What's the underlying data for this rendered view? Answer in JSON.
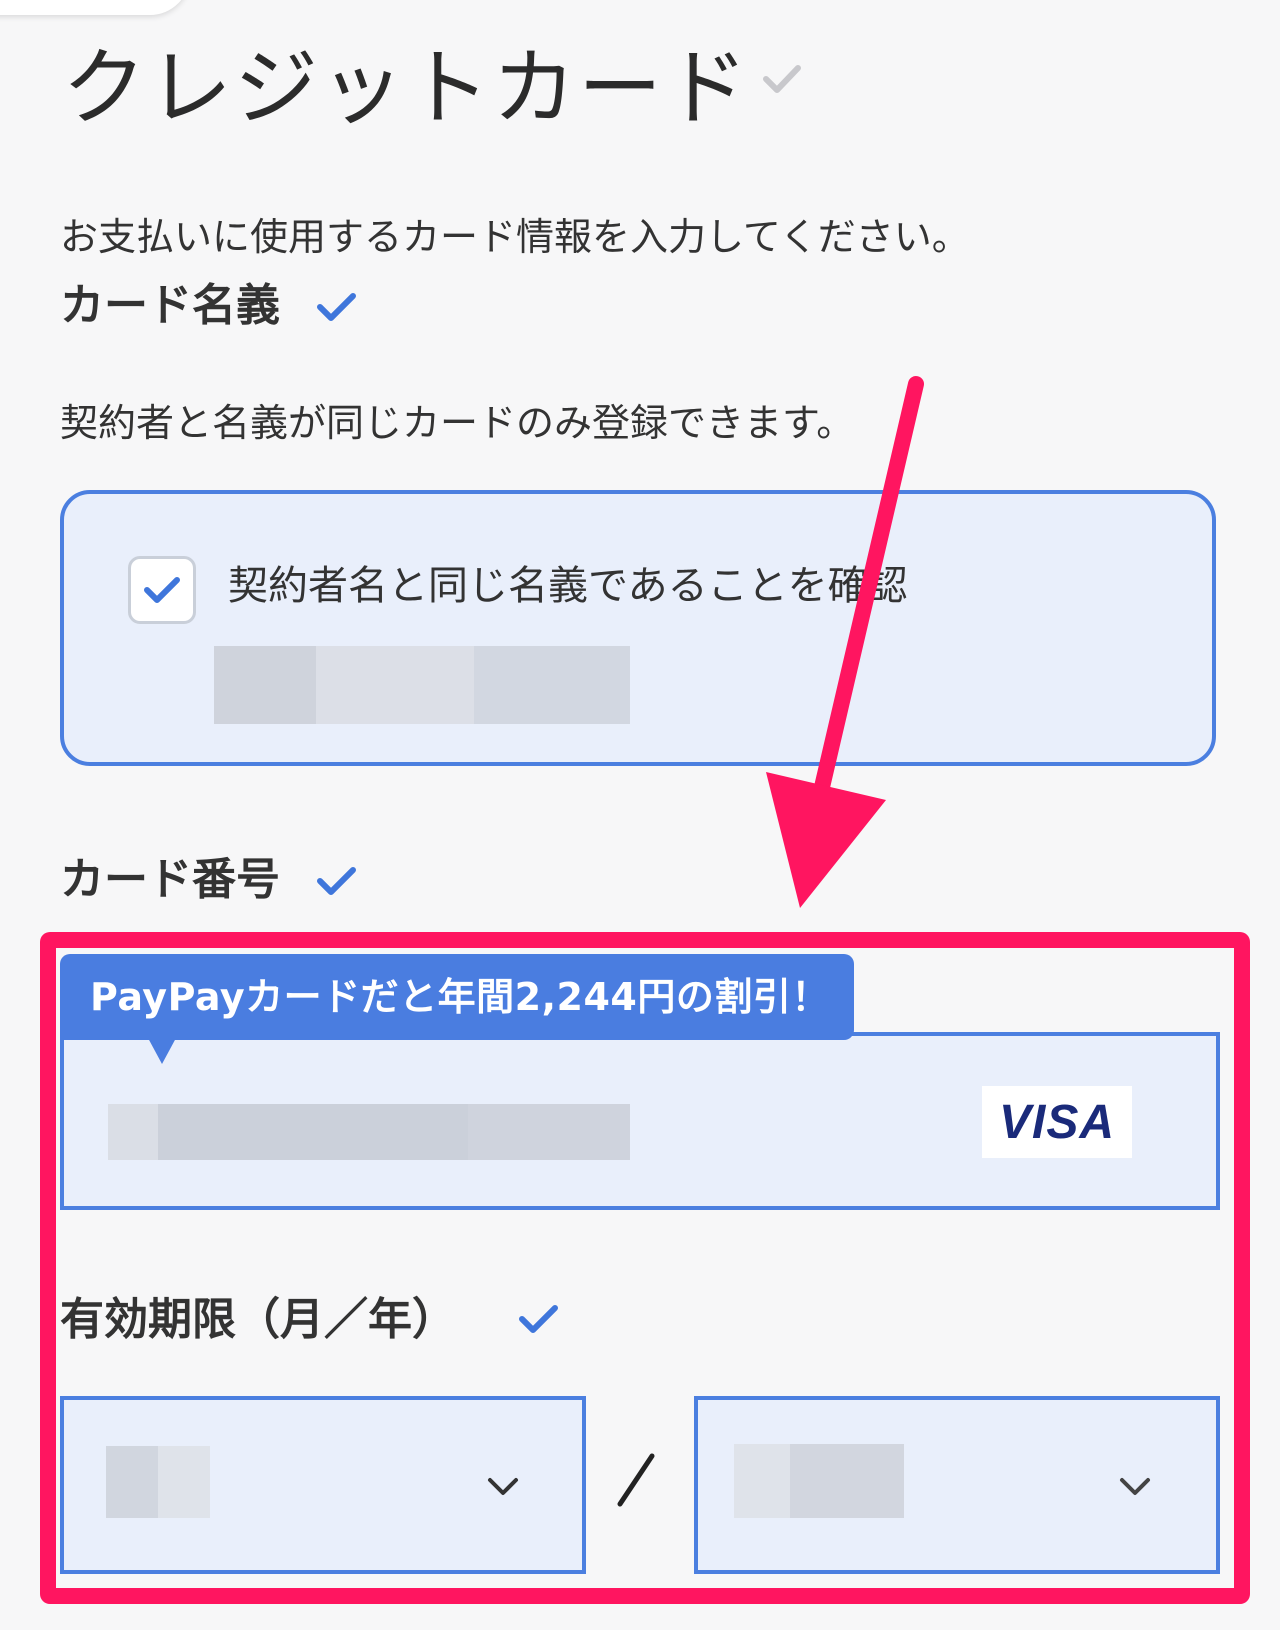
{
  "header": {
    "title": "クレジットカード",
    "intro": "お支払いに使用するカード情報を入力してください。"
  },
  "card_name": {
    "heading": "カード名義",
    "note": "契約者と名義が同じカードのみ登録できます。",
    "confirm_label": "契約者名と同じ名義であることを確認",
    "confirm_checked": true
  },
  "card_number": {
    "heading": "カード番号",
    "promo": "PayPayカードだと年間2,244円の割引！",
    "brand": "VISA"
  },
  "expiry": {
    "heading": "有効期限（月／年）",
    "separator": "/"
  },
  "colors": {
    "accent_blue": "#4b7fe0",
    "field_bg": "#e9effb",
    "annotation_red": "#ff1560",
    "background": "#f7f7f8"
  }
}
